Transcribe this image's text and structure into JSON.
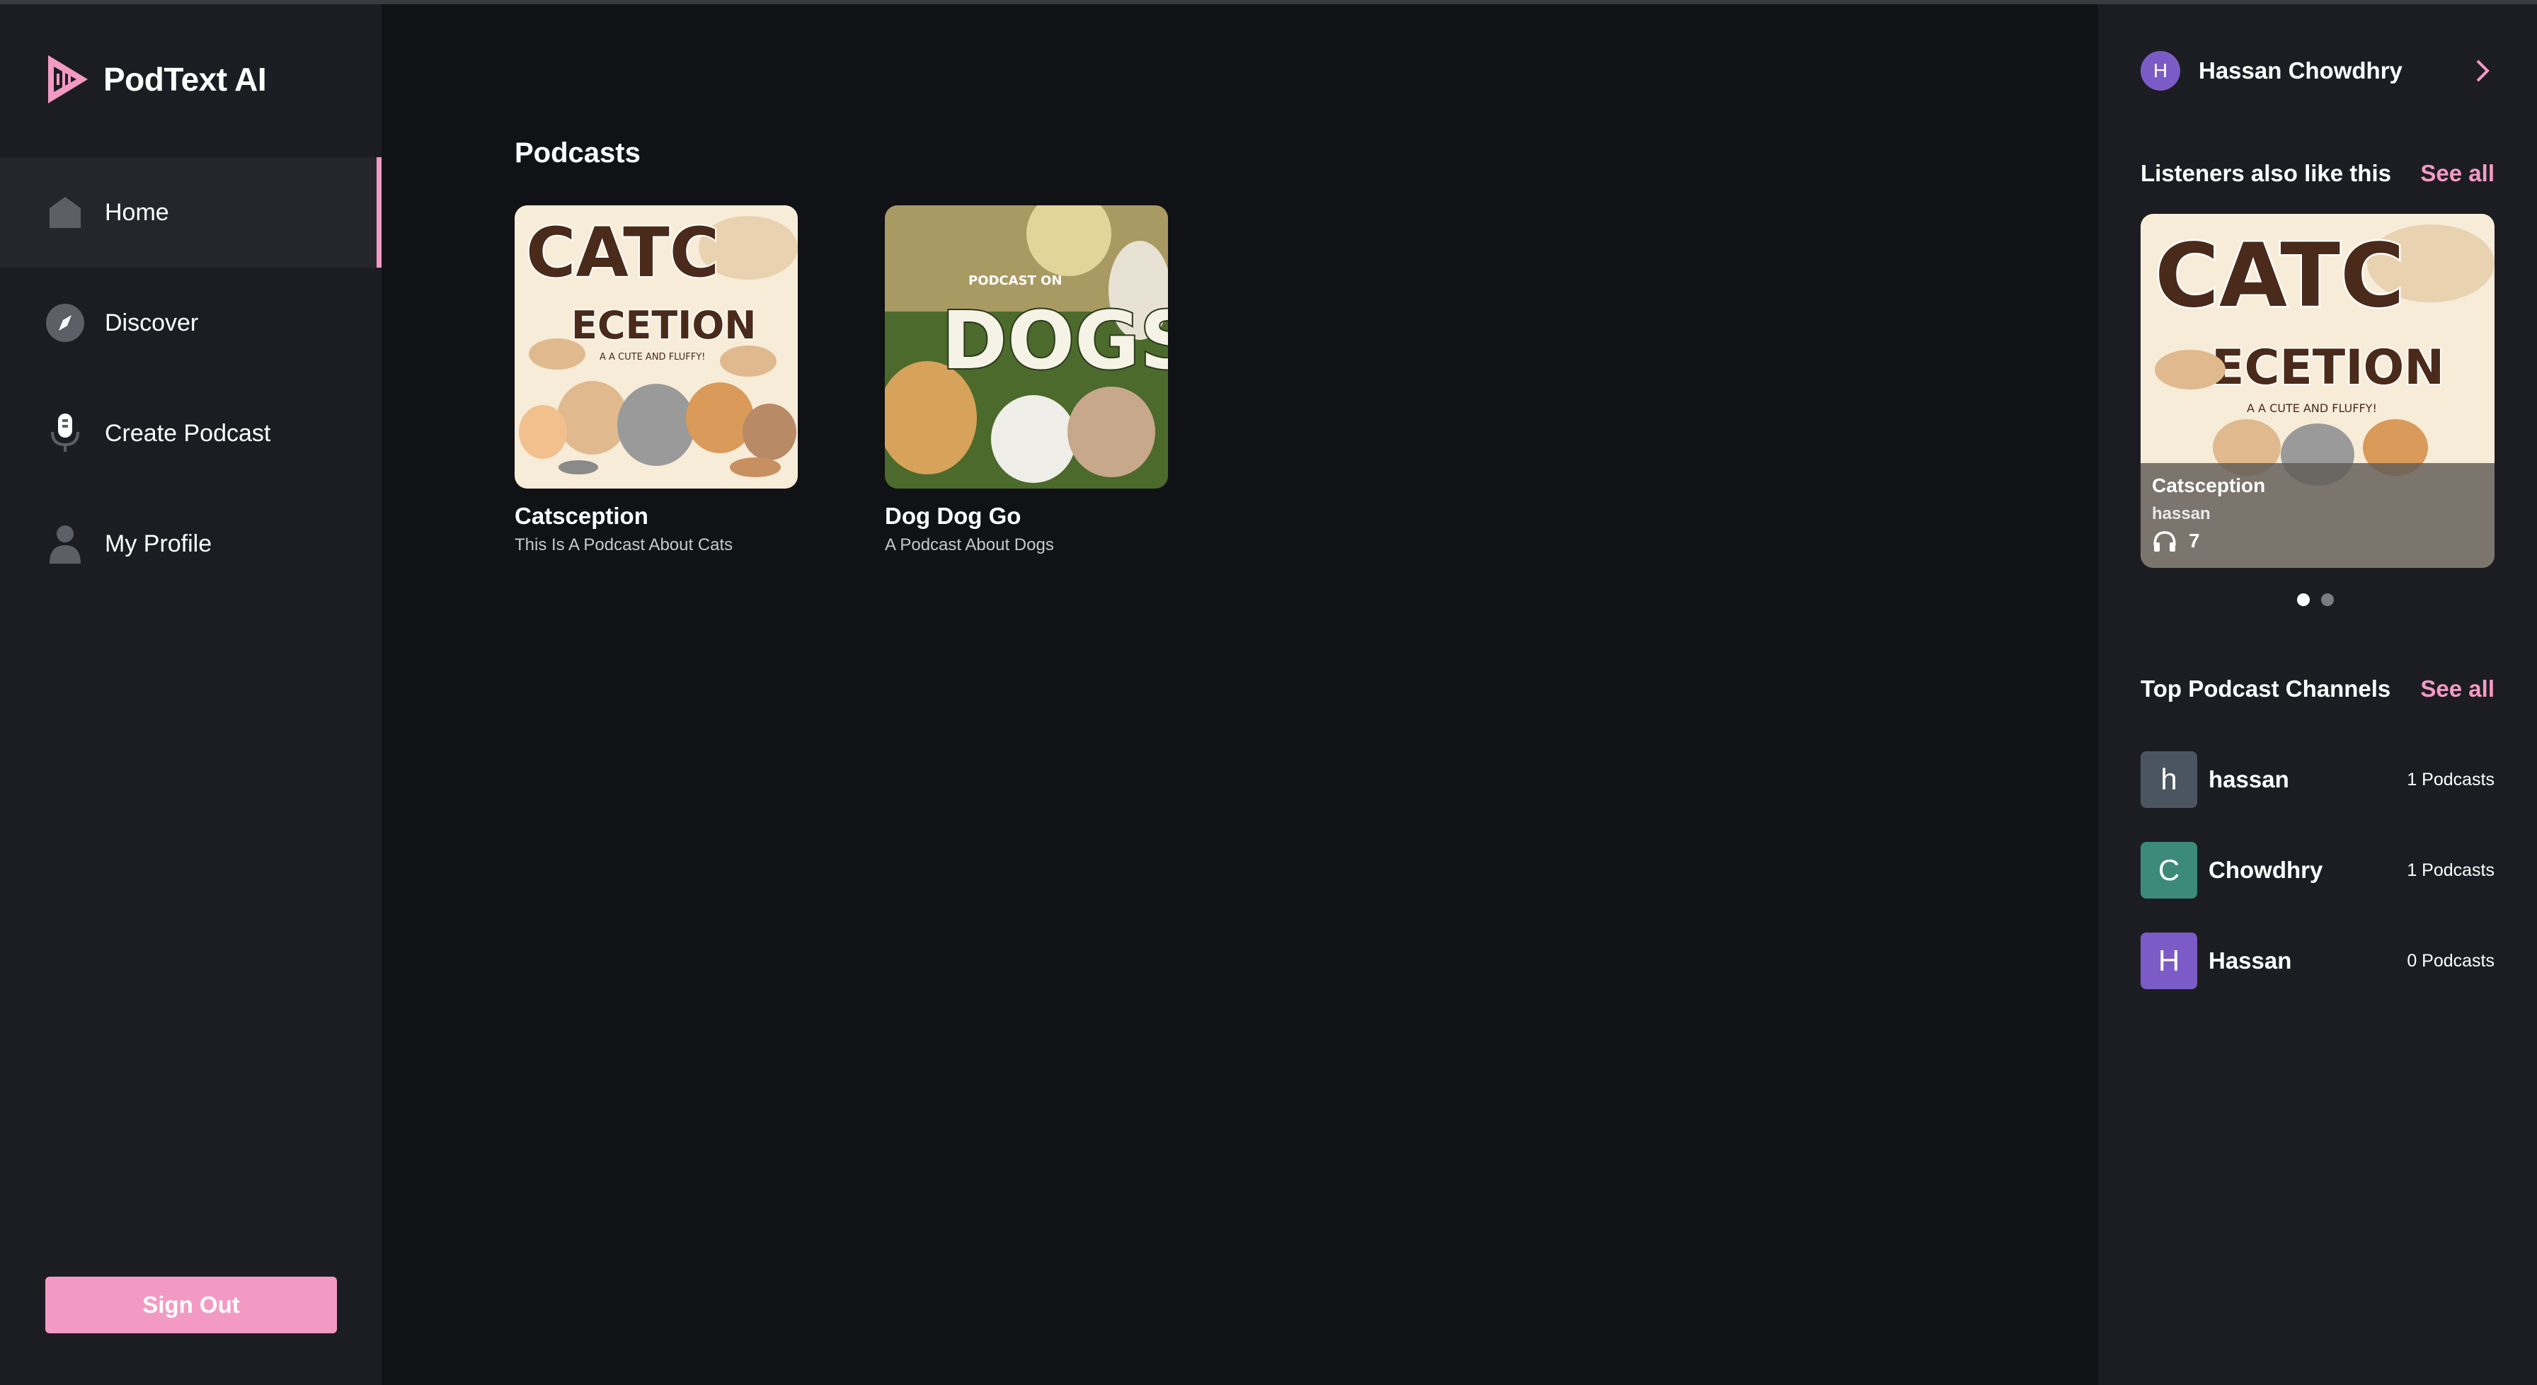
{
  "app": {
    "name": "PodText AI",
    "accent": "#f39ac4"
  },
  "sidebar": {
    "items": [
      {
        "label": "Home",
        "icon": "home-icon",
        "active": true
      },
      {
        "label": "Discover",
        "icon": "compass-icon",
        "active": false
      },
      {
        "label": "Create Podcast",
        "icon": "microphone-icon",
        "active": false
      },
      {
        "label": "My Profile",
        "icon": "user-icon",
        "active": false
      }
    ],
    "signout_label": "Sign Out"
  },
  "main": {
    "title": "Podcasts",
    "podcasts": [
      {
        "title": "Catsception",
        "description": "This Is A Podcast About Cats",
        "cover_text": [
          "CATC",
          "ECETION",
          "A A CUTE AND FLUFFY!"
        ]
      },
      {
        "title": "Dog Dog Go",
        "description": "A Podcast About Dogs",
        "cover_text": [
          "PODCAST ON",
          "DOGS"
        ]
      }
    ]
  },
  "right_panel": {
    "user": {
      "initial": "H",
      "name": "Hassan Chowdhry"
    },
    "listeners_also_like": {
      "title": "Listeners also like this",
      "see_all": "See all",
      "featured": {
        "title": "Catsception",
        "author": "hassan",
        "listeners": "7",
        "cover_text": [
          "CATC",
          "ECETION",
          "A A CUTE AND FLUFFY!"
        ]
      },
      "carousel_total": 2,
      "carousel_active": 1
    },
    "top_channels": {
      "title": "Top Podcast Channels",
      "see_all": "See all",
      "channels": [
        {
          "initial": "h",
          "name": "hassan",
          "count": "1 Podcasts",
          "color": "#4a5561"
        },
        {
          "initial": "C",
          "name": "Chowdhry",
          "count": "1 Podcasts",
          "color": "#3b8a7a"
        },
        {
          "initial": "H",
          "name": "Hassan",
          "count": "0 Podcasts",
          "color": "#7b5cc7"
        }
      ]
    }
  }
}
